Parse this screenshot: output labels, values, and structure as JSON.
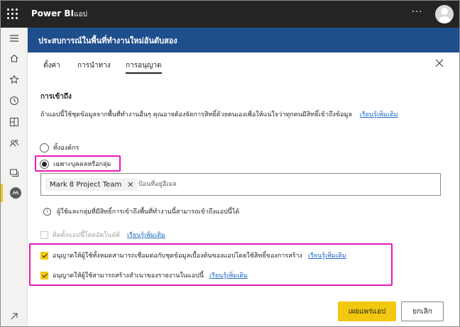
{
  "topbar": {
    "app_name": "Power BI",
    "crumb": "แอป",
    "more": "···"
  },
  "panel": {
    "title": "ประสบการณ์ในพื้นที่ทำงานใหม่อันดับสอง"
  },
  "tabs": [
    {
      "label": "ตั้งค่า"
    },
    {
      "label": "การนำทาง"
    },
    {
      "label": "การอนุญาต"
    }
  ],
  "access": {
    "title": "การเข้าถึง",
    "description": "ถ้าแอปนี้ใช้ชุดข้อมูลจากพื้นที่ทำงานอื่นๆ คุณอาจต้องจัดการสิทธิ์ด้วยตนเองเพื่อให้แน่ใจว่าทุกคนมีสิทธิ์เข้าถึงข้อมูล",
    "learn_more": "เรียนรู้เพิ่มเติม",
    "option_org": "ทั้งองค์กร",
    "option_specific": "เฉพาะบุคคลหรือกลุ่ม",
    "chip": "Mark 8 Project Team",
    "email_placeholder": "ป้อนที่อยู่อีเมล",
    "info": "ผู้ใช้และกลุ่มที่มีสิทธิ์การเข้าถึงพื้นที่ทำงานนี้สามารถเข้าถึงแอปนี้ได้"
  },
  "options": {
    "auto_install": "ติดตั้งแอปนี้โดยอัตโนมัติ",
    "auto_install_link": "เรียนรู้เพิ่มเติม",
    "build_permission": "อนุญาตให้ผู้ใช้ทั้งหมดสามารถเชื่อมต่อกับชุดข้อมูลเบื้องต้นของแอปโดยใช้สิทธิ์ของการสร้าง",
    "build_permission_link": "เรียนรู้เพิ่มเติม",
    "copy_reports": "อนุญาตให้ผู้ใช้สามารถสร้างสำเนาของรายงานในแอปนี้",
    "copy_reports_link": "เรียนรู้เพิ่มเติม"
  },
  "buttons": {
    "publish": "เผยแพร่แอป",
    "cancel": "ยกเลิก"
  },
  "colors": {
    "accent": "#f2c811",
    "header": "#1f4e8c",
    "highlight": "#e619b7",
    "link": "#1e6ac9"
  }
}
